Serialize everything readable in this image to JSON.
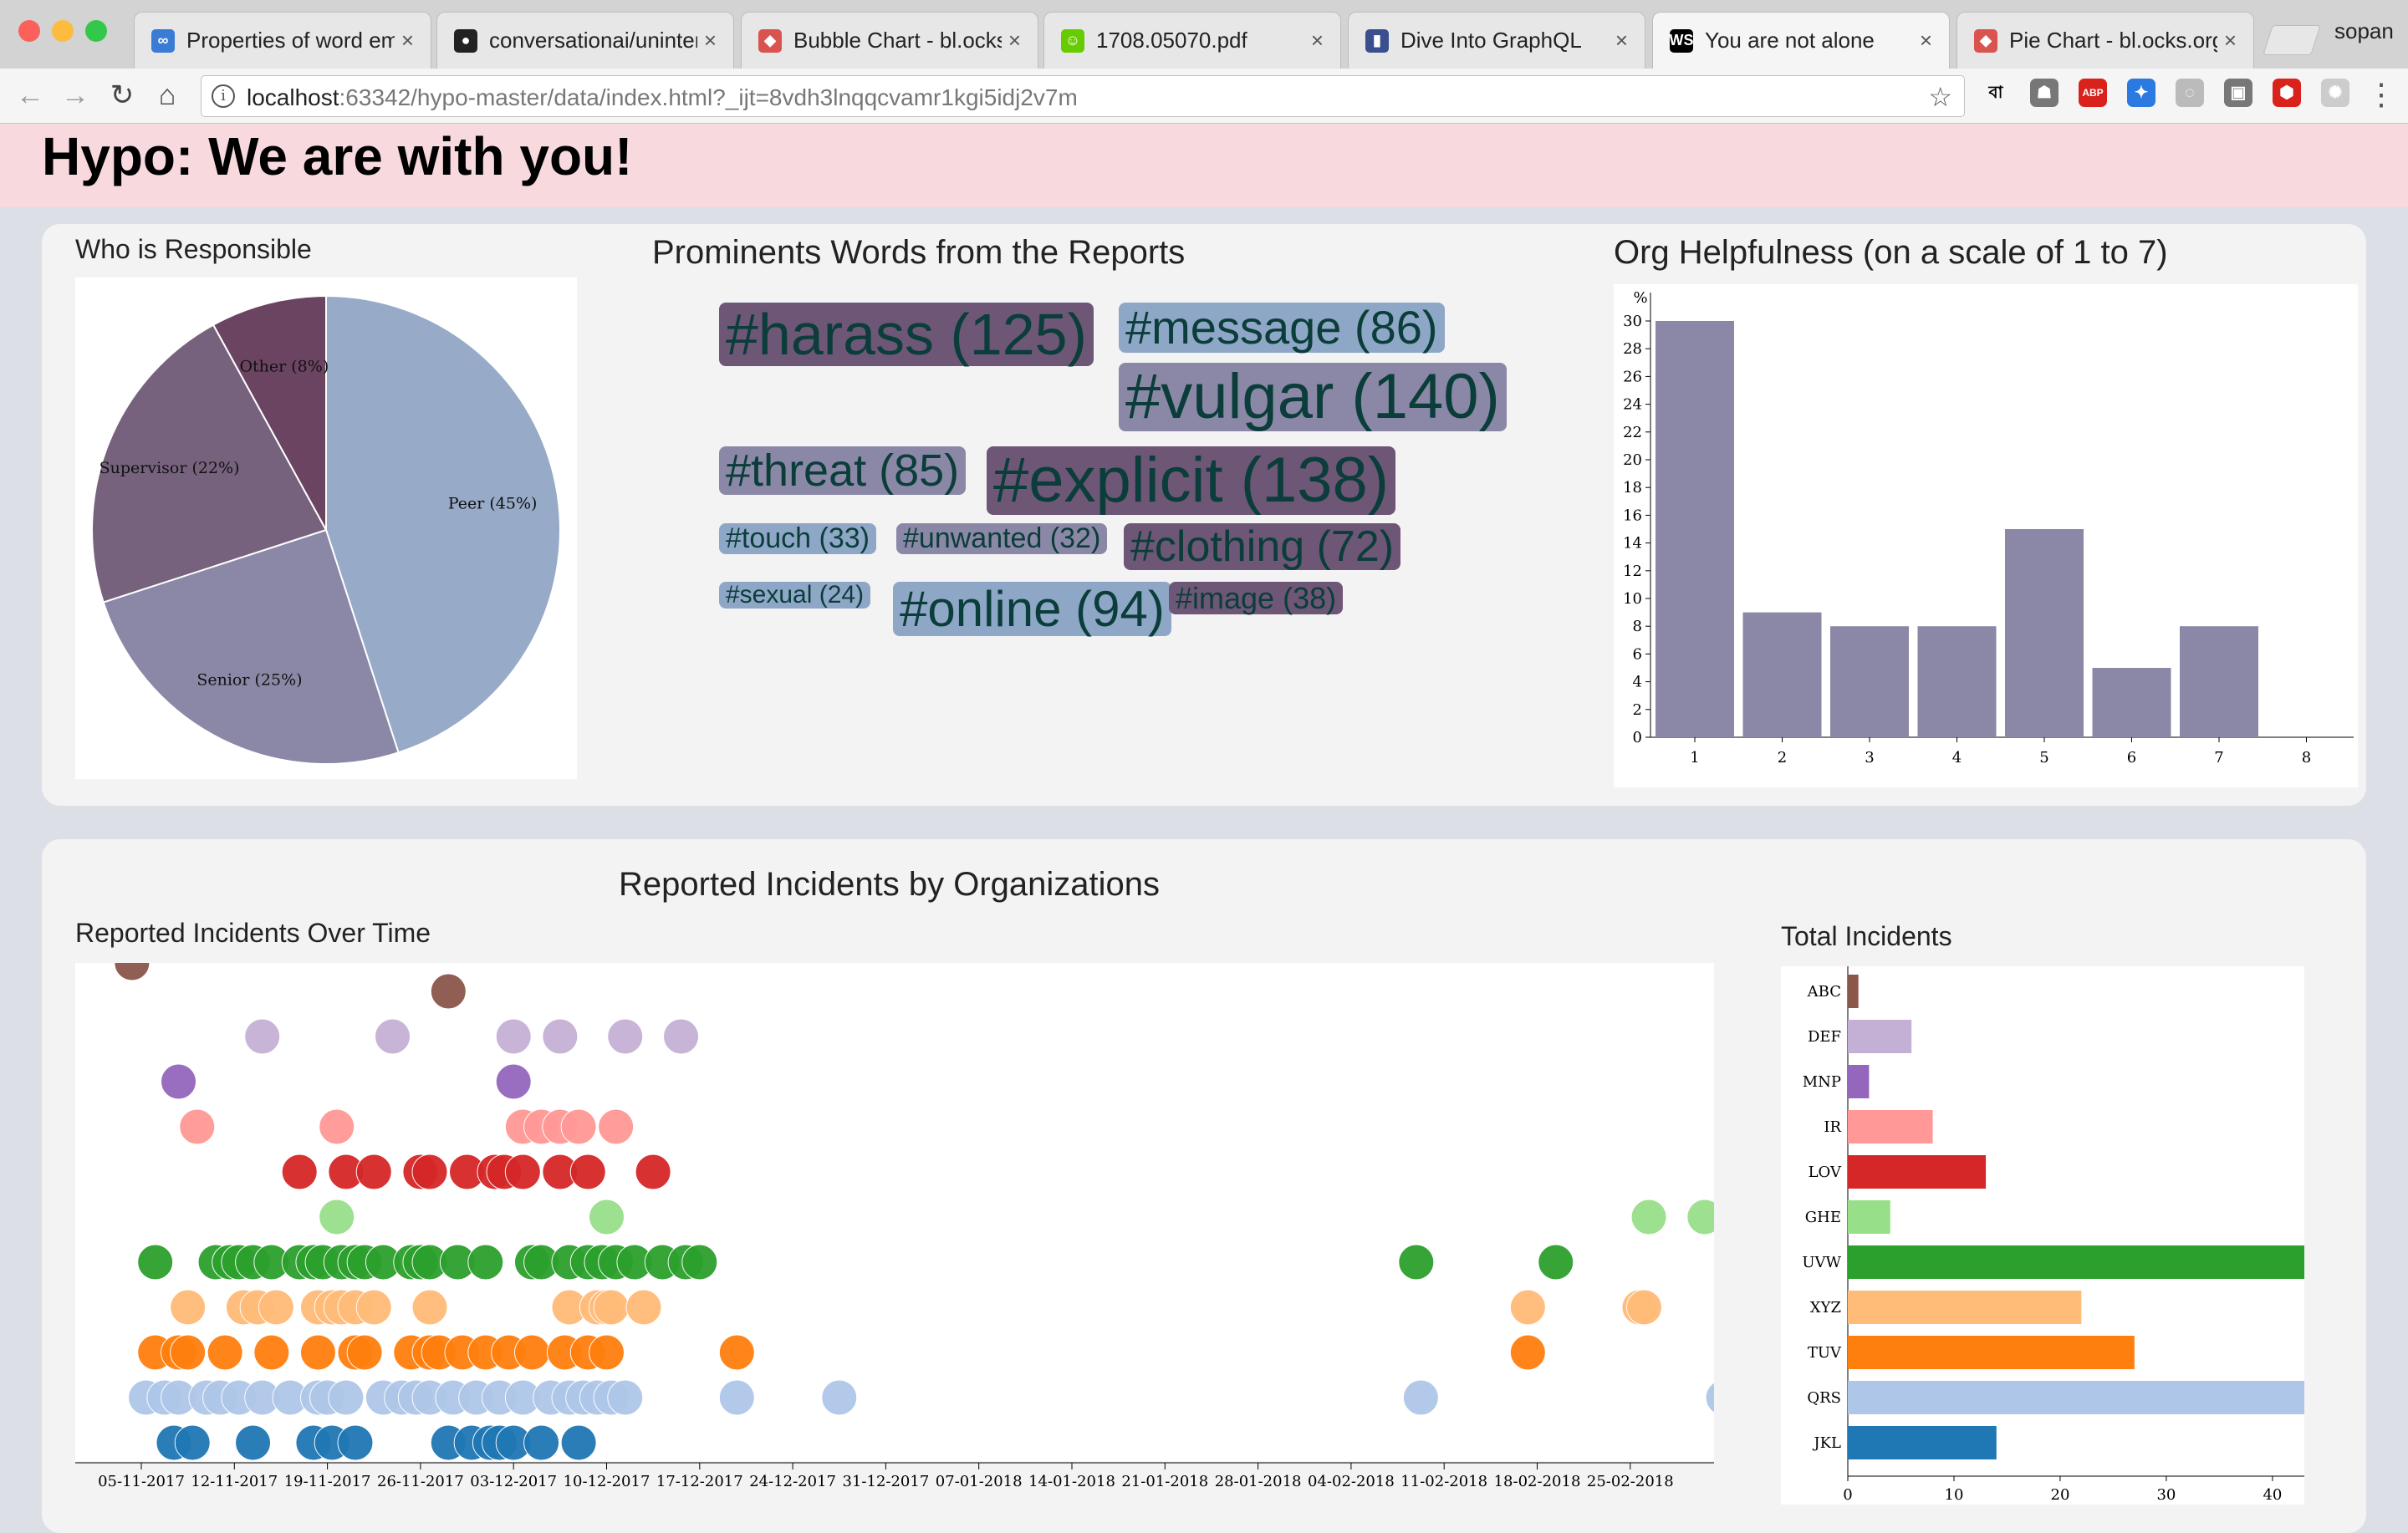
{
  "browser": {
    "tabs": [
      {
        "label": "Properties of word em",
        "icon": "infinity-icon",
        "color": "#3a7bd5",
        "glyph": "∞"
      },
      {
        "label": "conversationai/uninter",
        "icon": "github-icon",
        "color": "#222222",
        "glyph": "●"
      },
      {
        "label": "Bubble Chart - bl.ocks",
        "icon": "blocks-icon",
        "color": "#d9534f",
        "glyph": "◆"
      },
      {
        "label": "1708.05070.pdf",
        "icon": "smiley-icon",
        "color": "#66cc00",
        "glyph": "☺"
      },
      {
        "label": "Dive Into GraphQL",
        "icon": "book-icon",
        "color": "#3b4f8f",
        "glyph": "▮"
      },
      {
        "label": "You are not alone",
        "icon": "webstorm-icon",
        "color": "#000000",
        "glyph": "WS"
      },
      {
        "label": "Pie Chart - bl.ocks.org",
        "icon": "blocks-icon",
        "color": "#d9534f",
        "glyph": "◆"
      }
    ],
    "profile": "sopan",
    "url_host": "localhost",
    "url_rest": ":63342/hypo-master/data/index.html?_ijt=8vdh3lnqqcvamr1kgi5idj2v7m",
    "extensions": [
      {
        "name": "bangla-extension-icon",
        "glyph": "বা",
        "color": "#ffffff"
      },
      {
        "name": "ghost-extension-icon",
        "glyph": "☗",
        "color": "#777777"
      },
      {
        "name": "adblock-extension-icon",
        "glyph": "ABP",
        "color": "#d9221c"
      },
      {
        "name": "blue-extension-icon",
        "glyph": "✦",
        "color": "#2a7ae2"
      },
      {
        "name": "circle-extension-icon",
        "glyph": "◌",
        "color": "#bbbbbb"
      },
      {
        "name": "box-extension-icon",
        "glyph": "▣",
        "color": "#777777"
      },
      {
        "name": "shield-extension-icon",
        "glyph": "⬢",
        "color": "#d9221c"
      },
      {
        "name": "gear-extension-icon",
        "glyph": "✺",
        "color": "#cccccc"
      }
    ]
  },
  "page": {
    "title": "Hypo: We are with you!",
    "responsible_title": "Who is Responsible",
    "words_title": "Prominents Words from the Reports",
    "helpful_title": "Org Helpfulness (on a scale of 1 to 7)",
    "incidents_title": "Reported Incidents by Organizations",
    "over_time_title": "Reported Incidents Over Time",
    "total_title": "Total Incidents"
  },
  "colors": {
    "pie_peer": "#97aac7",
    "pie_senior": "#8a88a6",
    "pie_supervisor": "#77627e",
    "pie_other": "#6b4462",
    "bar": "#8a88a6"
  },
  "words": [
    {
      "text": "#harass (125)",
      "color": "#6e5677",
      "size": 70
    },
    {
      "text": "#message (86)",
      "color": "#8fa7c7",
      "size": 56
    },
    {
      "text": "#vulgar (140)",
      "color": "#8a88a6",
      "size": 76
    },
    {
      "text": "#threat (85)",
      "color": "#8a88a6",
      "size": 54
    },
    {
      "text": "#explicit (138)",
      "color": "#6e5677",
      "size": 76
    },
    {
      "text": "#touch (33)",
      "color": "#8fa7c7",
      "size": 34
    },
    {
      "text": "#unwanted (32)",
      "color": "#8a88a6",
      "size": 34
    },
    {
      "text": "#clothing (72)",
      "color": "#6e5677",
      "size": 52
    },
    {
      "text": "#sexual (24)",
      "color": "#8fa7c7",
      "size": 30
    },
    {
      "text": "#online (94)",
      "color": "#8fa7c7",
      "size": 60
    },
    {
      "text": "#image (38)",
      "color": "#6e5677",
      "size": 36
    }
  ],
  "chart_data": [
    {
      "type": "pie",
      "title": "Who is Responsible",
      "slices": [
        {
          "label": "Peer (45%)",
          "value": 45
        },
        {
          "label": "Senior (25%)",
          "value": 25
        },
        {
          "label": "Supervisor (22%)",
          "value": 22
        },
        {
          "label": "Other (8%)",
          "value": 8
        }
      ]
    },
    {
      "type": "bar",
      "title": "Org Helpfulness (on a scale of 1 to 7)",
      "ylabel": "%",
      "categories": [
        "1",
        "2",
        "3",
        "4",
        "5",
        "6",
        "7",
        "8"
      ],
      "values": [
        30,
        9,
        8,
        8,
        15,
        5,
        8,
        0
      ],
      "ylim": [
        0,
        30
      ],
      "yticks": [
        0,
        2,
        4,
        6,
        8,
        10,
        12,
        14,
        16,
        18,
        20,
        22,
        24,
        26,
        28,
        30
      ]
    },
    {
      "type": "scatter",
      "title": "Reported Incidents Over Time",
      "xticks": [
        "05-11-2017",
        "12-11-2017",
        "19-11-2017",
        "26-11-2017",
        "03-12-2017",
        "10-12-2017",
        "17-12-2017",
        "24-12-2017",
        "31-12-2017",
        "07-01-2018",
        "14-01-2018",
        "21-01-2018",
        "28-01-2018",
        "04-02-2018",
        "11-02-2018",
        "18-02-2018",
        "25-02-2018"
      ],
      "x_unit": "weeks after 05-11-2017",
      "series": [
        {
          "name": "ABC",
          "color": "#8c564b",
          "x": [
            -0.1,
            3.3
          ]
        },
        {
          "name": "DEF",
          "color": "#c5b0d5",
          "x": [
            1.3,
            2.7,
            4.0,
            4.5,
            5.2,
            5.8
          ]
        },
        {
          "name": "MNP",
          "color": "#9467bd",
          "x": [
            0.4,
            4.0
          ]
        },
        {
          "name": "IR",
          "color": "#ff9896",
          "x": [
            0.6,
            2.1,
            4.1,
            4.3,
            4.5,
            4.7,
            5.1
          ]
        },
        {
          "name": "LOV",
          "color": "#d62728",
          "x": [
            1.7,
            2.2,
            2.5,
            3.0,
            3.1,
            3.5,
            3.8,
            3.9,
            4.1,
            4.5,
            4.8,
            5.5
          ]
        },
        {
          "name": "GHE",
          "color": "#98df8a",
          "x": [
            2.1,
            5.0,
            16.2,
            16.8
          ]
        },
        {
          "name": "UVW",
          "color": "#2ca02c",
          "x": [
            0.15,
            0.8,
            0.95,
            1.05,
            1.2,
            1.4,
            1.7,
            1.85,
            1.95,
            2.15,
            2.3,
            2.4,
            2.6,
            2.9,
            3.0,
            3.1,
            3.4,
            3.7,
            4.2,
            4.3,
            4.6,
            4.8,
            4.95,
            5.1,
            5.3,
            5.6,
            5.85,
            6.0,
            13.7,
            15.2
          ]
        },
        {
          "name": "XYZ",
          "color": "#ffbb78",
          "x": [
            0.5,
            1.1,
            1.25,
            1.45,
            1.9,
            2.05,
            2.15,
            2.3,
            2.5,
            3.1,
            4.6,
            4.9,
            5.0,
            5.05,
            5.4,
            14.9,
            16.1,
            16.15
          ]
        },
        {
          "name": "TUV",
          "color": "#ff7f0e",
          "x": [
            0.15,
            0.4,
            0.5,
            0.9,
            1.4,
            1.9,
            2.3,
            2.4,
            2.9,
            3.1,
            3.2,
            3.45,
            3.7,
            3.95,
            4.2,
            4.55,
            4.8,
            5.0,
            6.4,
            14.9
          ]
        },
        {
          "name": "QRS",
          "color": "#aec7e8",
          "x": [
            0.05,
            0.25,
            0.4,
            0.7,
            0.85,
            1.05,
            1.3,
            1.6,
            1.9,
            2.0,
            2.2,
            2.6,
            2.8,
            2.95,
            3.1,
            3.35,
            3.6,
            3.85,
            4.1,
            4.4,
            4.6,
            4.75,
            4.9,
            5.05,
            5.2,
            6.4,
            7.5,
            13.75,
            17.0
          ]
        },
        {
          "name": "JKL",
          "color": "#1f77b4",
          "x": [
            0.35,
            0.55,
            1.2,
            1.85,
            2.05,
            2.3,
            3.3,
            3.55,
            3.75,
            3.85,
            4.0,
            4.3,
            4.7
          ]
        }
      ]
    },
    {
      "type": "bar",
      "title": "Total Incidents",
      "orientation": "horizontal",
      "categories": [
        "ABC",
        "DEF",
        "MNP",
        "IR",
        "LOV",
        "GHE",
        "UVW",
        "XYZ",
        "TUV",
        "QRS",
        "JKL"
      ],
      "values": [
        1,
        6,
        2,
        8,
        13,
        4,
        43,
        22,
        27,
        43,
        14
      ],
      "xticks": [
        0,
        10,
        20,
        30,
        40
      ],
      "xlim": [
        0,
        43
      ]
    }
  ]
}
